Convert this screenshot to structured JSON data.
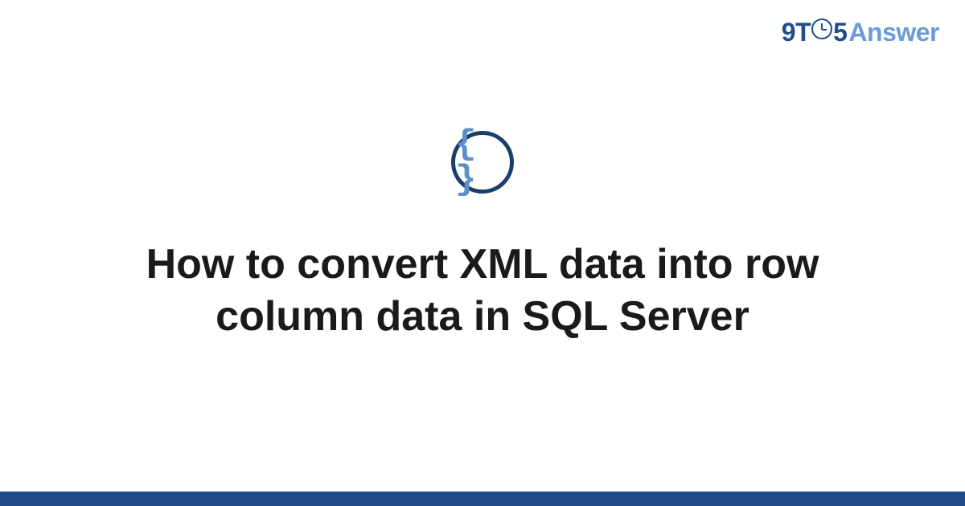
{
  "logo": {
    "part1": "9T",
    "part2": "5",
    "part3": "Answer"
  },
  "icon": {
    "braces_text": "{ }",
    "name": "code-braces-icon"
  },
  "title": "How to convert XML data into row column data in SQL Server",
  "colors": {
    "brand_dark": "#1f4d8c",
    "brand_light": "#6b9bd8",
    "icon_border": "#1a3f6b",
    "braces": "#5b8fc9",
    "text": "#1a1a1a"
  }
}
